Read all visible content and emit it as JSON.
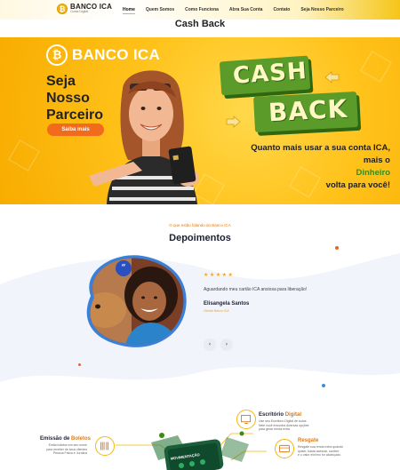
{
  "nav": {
    "logo": {
      "name": "BANCO ICA",
      "subtitle": "Conta Digital",
      "coin_glyph": "₿"
    },
    "links": [
      {
        "label": "Home",
        "active": true
      },
      {
        "label": "Quem Somos",
        "active": false
      },
      {
        "label": "Como Funciona",
        "active": false
      },
      {
        "label": "Abra Sua Conta",
        "active": false
      },
      {
        "label": "Contato",
        "active": false
      },
      {
        "label": "Seja Nosso Parceiro",
        "active": false
      }
    ]
  },
  "page_title": "Cash Back",
  "banner": {
    "brand": "BANCO ICA",
    "coin_glyph": "₿",
    "tagline": [
      "Seja",
      "Nosso",
      "Parceiro"
    ],
    "cta_label": "Saiba mais",
    "sign_top": "CASH",
    "sign_bottom": "BACK",
    "slogan_line1": "Quanto mais usar a sua conta ICA,",
    "slogan_line2_pre": "mais o ",
    "slogan_line2_highlight": "Dinheiro",
    "slogan_line2_post": " volta para você!",
    "colors": {
      "background": "#ffc21a",
      "sign": "#5b9b2a",
      "cta": "#f26b1d"
    }
  },
  "testimonials": {
    "eyebrow": "O que estão falando do Banco ICA",
    "title": "Depoimentos",
    "quote_glyph": "“",
    "rating": 5,
    "stars": "★★★★★",
    "quote": "Aguardando meu cartão ICA ansiosa para liberação!",
    "name": "Elisangela Santos",
    "role": "Cliente Banco ICA",
    "prev_glyph": "‹",
    "next_glyph": "›"
  },
  "features": {
    "items": [
      {
        "title_pre": "Emissão de ",
        "title_highlight": "Boletos",
        "desc": [
          "Emita boletos em seu nome",
          "para receber de seus clientes",
          "Pessoa Física e Jurídica"
        ],
        "icon": "barcode-icon"
      },
      {
        "title_pre": "Escritório ",
        "title_highlight": "Digital",
        "desc": [
          "Use seu Escritório Digital de todos",
          "Nele você encontra diversas opções",
          "para gerar renda extra"
        ],
        "icon": "monitor-icon"
      },
      {
        "title_pre": "",
        "title_highlight": "Resgate",
        "desc": [
          "Resgate sua renda extra quando",
          "quiser, basta acessar, conferir",
          "e o valor mínimo for alcançado."
        ],
        "icon": "wallet-icon"
      }
    ],
    "phone_label": "MOVIMENTAÇÃO"
  }
}
